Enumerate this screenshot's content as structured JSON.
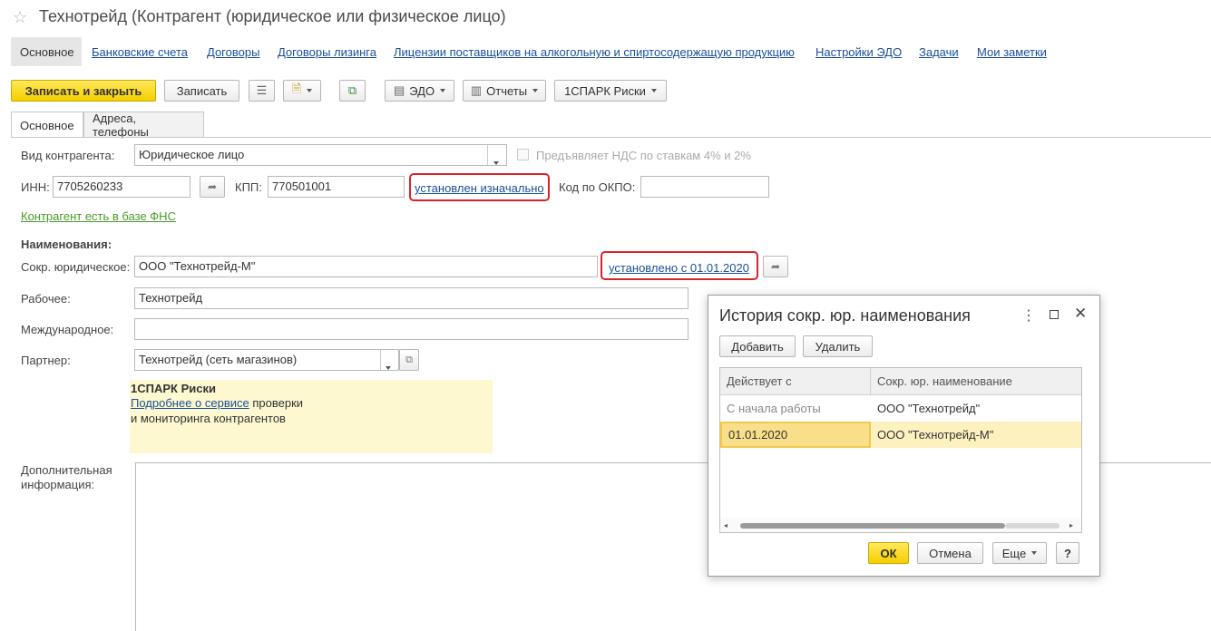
{
  "window": {
    "title": "Технотрейд (Контрагент (юридическое или физическое лицо)"
  },
  "nav": {
    "main": "Основное",
    "links": [
      "Банковские счета",
      "Договоры",
      "Договоры лизинга",
      "Лицензии поставщиков на алкогольную и спиртосодержащую продукцию",
      "Настройки ЭДО",
      "Задачи",
      "Мои заметки"
    ]
  },
  "toolbar": {
    "save_close": "Записать и закрыть",
    "save": "Записать",
    "edo": "ЭДО",
    "reports": "Отчеты",
    "spark": "1СПАРК Риски"
  },
  "tabs": [
    "Основное",
    "Адреса, телефоны"
  ],
  "form": {
    "kind_label": "Вид контрагента:",
    "kind_value": "Юридическое лицо",
    "nds_label": "Предъявляет НДС по ставкам 4% и 2%",
    "inn_label": "ИНН:",
    "inn_value": "7705260233",
    "kpp_label": "КПП:",
    "kpp_value": "770501001",
    "kpp_link": "установлен изначально",
    "okpo_label": "Код по ОКПО:",
    "okpo_value": "",
    "fns_link": "Контрагент есть в базе ФНС",
    "names_header": "Наименования:",
    "short_label": "Сокр. юридическое:",
    "short_value": "ООО \"Технотрейд-М\"",
    "short_link": "установлено с 01.01.2020",
    "work_label": "Рабочее:",
    "work_value": "Технотрейд",
    "intl_label": "Международное:",
    "intl_value": "",
    "partner_label": "Партнер:",
    "partner_value": "Технотрейд (сеть магазинов)",
    "extra_label_1": "Дополнительная",
    "extra_label_2": "информация:"
  },
  "spark_block": {
    "title": "1СПАРК Риски",
    "link": "Подробнее о сервисе",
    "text1": " проверки",
    "text2": "и мониторинга контрагентов"
  },
  "dialog": {
    "title": "История сокр. юр. наименования",
    "add": "Добавить",
    "delete": "Удалить",
    "columns": [
      "Действует с",
      "Сокр. юр. наименование"
    ],
    "rows": [
      {
        "date": "С начала работы",
        "name": "ООО \"Технотрейд\""
      },
      {
        "date": "01.01.2020",
        "name": "ООО \"Технотрейд-М\""
      }
    ],
    "ok": "ОК",
    "cancel": "Отмена",
    "more": "Еще",
    "help": "?"
  },
  "colors": {
    "accent_yellow": "#f5cf00",
    "link_blue": "#1a4f9a",
    "highlight_red": "#d9232b",
    "green_link": "#4a9a2a"
  }
}
